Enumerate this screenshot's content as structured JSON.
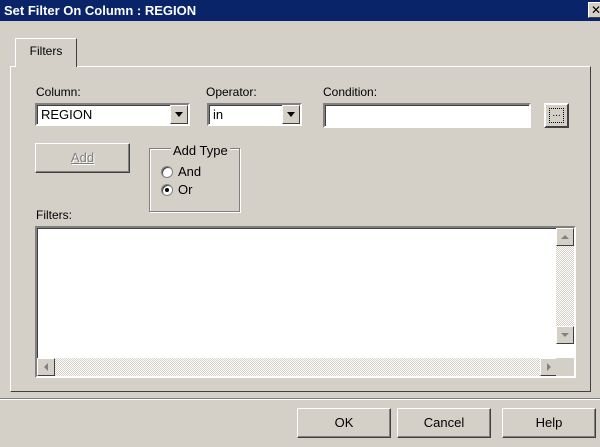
{
  "window": {
    "title": "Set Filter On Column : REGION",
    "close_glyph": "✕"
  },
  "tabs": [
    {
      "label": "Filters"
    }
  ],
  "form": {
    "column": {
      "label": "Column:",
      "value": "REGION"
    },
    "operator": {
      "label": "Operator:",
      "value": "in"
    },
    "condition": {
      "label": "Condition:",
      "value": ""
    },
    "ellipsis_label": "..."
  },
  "add_button": {
    "label": "Add",
    "mnemonic_underlined": "A"
  },
  "add_type": {
    "legend": "Add Type",
    "options": [
      {
        "label": "And",
        "checked": false
      },
      {
        "label": "Or",
        "checked": true
      }
    ]
  },
  "filters_list": {
    "label": "Filters:",
    "items": []
  },
  "footer": {
    "ok_label": "OK",
    "cancel_label": "Cancel",
    "help_label": "Help"
  }
}
